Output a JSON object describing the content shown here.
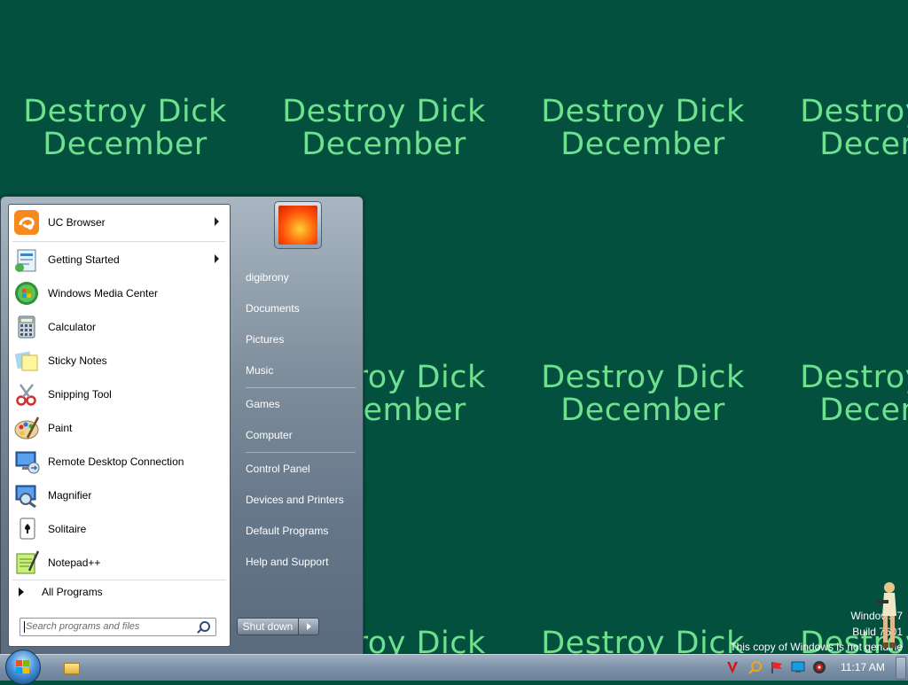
{
  "wallpaper": {
    "line1": "Destroy Dick",
    "line2": "December",
    "text_color": "#6fe08d",
    "background": "#03503f"
  },
  "start_menu": {
    "pinned": [
      {
        "label": "UC Browser",
        "icon": "uc-browser-icon",
        "has_submenu": true
      },
      {
        "label": "Getting Started",
        "icon": "getting-started-icon",
        "has_submenu": true
      },
      {
        "label": "Windows Media Center",
        "icon": "media-center-icon",
        "has_submenu": false
      },
      {
        "label": "Calculator",
        "icon": "calculator-icon",
        "has_submenu": false
      },
      {
        "label": "Sticky Notes",
        "icon": "sticky-notes-icon",
        "has_submenu": false
      },
      {
        "label": "Snipping Tool",
        "icon": "snipping-tool-icon",
        "has_submenu": false
      },
      {
        "label": "Paint",
        "icon": "paint-icon",
        "has_submenu": false
      },
      {
        "label": "Remote Desktop Connection",
        "icon": "remote-desktop-icon",
        "has_submenu": false
      },
      {
        "label": "Magnifier",
        "icon": "magnifier-icon",
        "has_submenu": false
      },
      {
        "label": "Solitaire",
        "icon": "solitaire-icon",
        "has_submenu": false
      },
      {
        "label": "Notepad++",
        "icon": "notepadpp-icon",
        "has_submenu": false
      }
    ],
    "all_programs": "All Programs",
    "search_placeholder": "Search programs and files",
    "right_items": [
      {
        "label": "digibrony"
      },
      {
        "label": "Documents"
      },
      {
        "label": "Pictures"
      },
      {
        "label": "Music"
      },
      {
        "label": "Games"
      },
      {
        "label": "Computer"
      },
      {
        "label": "Control Panel"
      },
      {
        "label": "Devices and Printers"
      },
      {
        "label": "Default Programs"
      },
      {
        "label": "Help and Support"
      }
    ],
    "shutdown_label": "Shut down"
  },
  "taskbar": {
    "clock": "11:17 AM",
    "tray_icons": [
      "antivirus-v-icon",
      "search-tray-icon",
      "flag-tray-icon",
      "network-tray-icon",
      "volume-tray-icon"
    ]
  },
  "genuine_notice": {
    "line1": "Windows 7",
    "line2": "Build 7601",
    "line3": "This copy of Windows is not genuine"
  }
}
